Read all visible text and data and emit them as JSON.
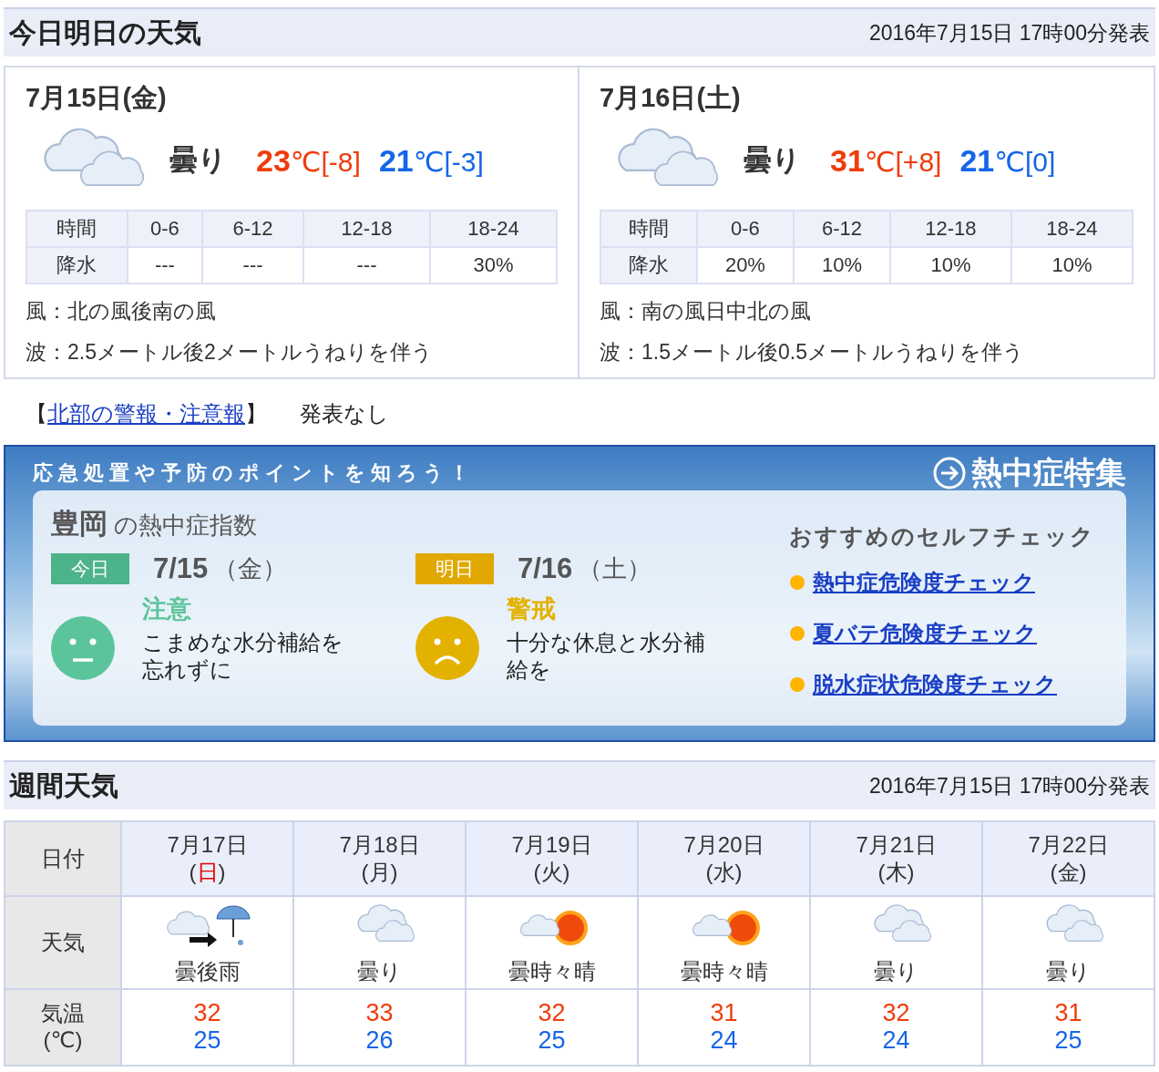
{
  "today_header": {
    "title": "今日明日の天気",
    "issued": "2016年7月15日 17時00分発表"
  },
  "days": [
    {
      "date": "7月15日(金)",
      "weather": "曇り",
      "kind": "cloudy",
      "high": {
        "value": "23",
        "unit": "℃",
        "diff": "[-8]"
      },
      "low": {
        "value": "21",
        "unit": "℃",
        "diff": "[-3]"
      },
      "rain_table": {
        "header": [
          "時間",
          "0-6",
          "6-12",
          "12-18",
          "18-24"
        ],
        "row": [
          "降水",
          "---",
          "---",
          "---",
          "30%"
        ]
      },
      "wind": {
        "label": "風：",
        "text": "北の風後南の風"
      },
      "wave": {
        "label": "波：",
        "text": "2.5メートル後2メートルうねりを伴う"
      }
    },
    {
      "date": "7月16日(土)",
      "weather": "曇り",
      "kind": "cloudy",
      "high": {
        "value": "31",
        "unit": "℃",
        "diff": "[+8]"
      },
      "low": {
        "value": "21",
        "unit": "℃",
        "diff": "[0]"
      },
      "rain_table": {
        "header": [
          "時間",
          "0-6",
          "6-12",
          "12-18",
          "18-24"
        ],
        "row": [
          "降水",
          "20%",
          "10%",
          "10%",
          "10%"
        ]
      },
      "wind": {
        "label": "風：",
        "text": "南の風日中北の風"
      },
      "wave": {
        "label": "波：",
        "text": "1.5メートル後0.5メートルうねりを伴う"
      }
    }
  ],
  "warnings": {
    "open": "【",
    "link": "北部の警報・注意報",
    "close": "】",
    "status": "発表なし"
  },
  "heat_banner": {
    "tagline": "応急処置や予防のポイントを知ろう！",
    "feature_link": "熱中症特集",
    "place": "豊岡",
    "index_title": "の熱中症指数",
    "entries": [
      {
        "badge": "今日",
        "kind": "caution",
        "date": "7/15",
        "weekday": "（金）",
        "level": "注意",
        "color": "#5cc49a",
        "advice": "こまめな水分補給を忘れずに"
      },
      {
        "badge": "明日",
        "kind": "warning",
        "date": "7/16",
        "weekday": "（土）",
        "level": "警戒",
        "color": "#e3b100",
        "advice": "十分な休息と水分補給を"
      }
    ],
    "check_title": "おすすめのセルフチェック",
    "checks": [
      "熱中症危険度チェック",
      "夏バテ危険度チェック",
      "脱水症状危険度チェック"
    ]
  },
  "week_header": {
    "title": "週間天気",
    "issued": "2016年7月15日 17時00分発表"
  },
  "week": {
    "row_labels": [
      "日付",
      "天気",
      "気温\n(℃)"
    ],
    "days": [
      {
        "date": "7月17日",
        "open": "(",
        "weekday": "日",
        "close": ")",
        "color": "#e60000",
        "kind": "cloudy-then-rain",
        "weather": "曇後雨",
        "high": "32",
        "low": "25"
      },
      {
        "date": "7月18日",
        "open": "(",
        "weekday": "月",
        "close": ")",
        "color": "#333333",
        "kind": "cloudy",
        "weather": "曇り",
        "high": "33",
        "low": "26"
      },
      {
        "date": "7月19日",
        "open": "(",
        "weekday": "火",
        "close": ")",
        "color": "#333333",
        "kind": "cloudy-sometimes-sunny",
        "weather": "曇時々晴",
        "high": "32",
        "low": "25"
      },
      {
        "date": "7月20日",
        "open": "(",
        "weekday": "水",
        "close": ")",
        "color": "#333333",
        "kind": "cloudy-sometimes-sunny",
        "weather": "曇時々晴",
        "high": "31",
        "low": "24"
      },
      {
        "date": "7月21日",
        "open": "(",
        "weekday": "木",
        "close": ")",
        "color": "#333333",
        "kind": "cloudy",
        "weather": "曇り",
        "high": "32",
        "low": "24"
      },
      {
        "date": "7月22日",
        "open": "(",
        "weekday": "金",
        "close": ")",
        "color": "#333333",
        "kind": "cloudy",
        "weather": "曇り",
        "high": "31",
        "low": "25"
      }
    ]
  }
}
